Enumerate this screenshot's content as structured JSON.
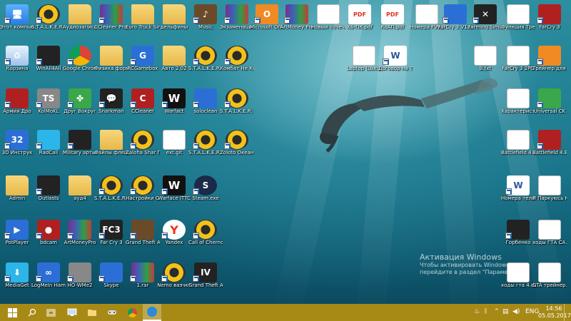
{
  "watermark": {
    "title": "Активация Windows",
    "subtitle": "Чтобы активировать Windows, перейдите в раздел \"Параметры\"."
  },
  "taskbar": {
    "language": "ENG",
    "time": "14:56",
    "date": "05.05.2017"
  },
  "icons": [
    {
      "label": "Этот компьютер",
      "kind": "pc",
      "glyph": "🖥"
    },
    {
      "label": "S.T.A.L.K.E.R. World Tour",
      "kind": "rad",
      "glyph": ""
    },
    {
      "label": "Аудиозаписи Владислав",
      "kind": "folder",
      "glyph": ""
    },
    {
      "label": "CCleaner Pro Коллекция",
      "kind": "rar",
      "glyph": ""
    },
    {
      "label": "Euro Truck Simulator 2",
      "kind": "folder",
      "glyph": ""
    },
    {
      "label": "дельфины",
      "kind": "folder",
      "glyph": ""
    },
    {
      "label": "Music",
      "kind": "brown",
      "glyph": "♪"
    },
    {
      "label": "Экзаменационные билеты ПДД",
      "kind": "rar",
      "glyph": ""
    },
    {
      "label": "Microsoft Office 2016",
      "kind": "orange",
      "glyph": "O"
    },
    {
      "label": "ArtMoney Pro",
      "kind": "rar",
      "glyph": ""
    },
    {
      "label": "Новый точечный рисунок",
      "kind": "doc",
      "glyph": ""
    },
    {
      "label": "ХБ-ПК.pdf",
      "kind": "pdf",
      "glyph": "PDF"
    },
    {
      "label": "КоАП.pdf",
      "kind": "pdf",
      "glyph": "PDF"
    },
    {
      "label": "Номера FVWD.txt",
      "kind": "doc",
      "glyph": ""
    },
    {
      "label": "FarCry 3 V1.05 DLC",
      "kind": "blue",
      "glyph": ""
    },
    {
      "label": "Farming Simulator 2017",
      "kind": "dark",
      "glyph": "✕"
    },
    {
      "label": "Функция Трейнер",
      "kind": "doc",
      "glyph": ""
    },
    {
      "label": "FarCry 3",
      "kind": "red",
      "glyph": ""
    },
    {
      "label": "Корзина",
      "kind": "bin",
      "glyph": "♻"
    },
    {
      "label": "WinAll4All",
      "kind": "dark",
      "glyph": ""
    },
    {
      "label": "Google Chrome",
      "kind": "chrome",
      "glyph": ""
    },
    {
      "label": "Физика формулы",
      "kind": "folder",
      "glyph": ""
    },
    {
      "label": "RCGamebox",
      "kind": "blue",
      "glyph": "G"
    },
    {
      "label": "Авто 2.02",
      "kind": "folder",
      "glyph": ""
    },
    {
      "label": "S.T.A.L.K.E.R. Call of Pripyat",
      "kind": "rad",
      "glyph": ""
    },
    {
      "label": "Комбат Не Колхоз",
      "kind": "rad",
      "glyph": ""
    },
    {
      "label": "Laptop (Luxury) Б",
      "kind": "doc",
      "glyph": ""
    },
    {
      "label": "Договор на Т СДЕ",
      "kind": "word",
      "glyph": "W"
    },
    {
      "label": "B.txt",
      "kind": "doc",
      "glyph": ""
    },
    {
      "label": "FarCry 3 2PG",
      "kind": "doc",
      "glyph": ""
    },
    {
      "label": "Трейнер для FC3 +10",
      "kind": "orange",
      "glyph": ""
    },
    {
      "label": "Армия Дро",
      "kind": "red",
      "glyph": ""
    },
    {
      "label": "KolMoKL",
      "kind": "gray",
      "glyph": "TS"
    },
    {
      "label": "Друг Вокруг",
      "kind": "green",
      "glyph": "✤"
    },
    {
      "label": "Snarkman",
      "kind": "dark",
      "glyph": "💬"
    },
    {
      "label": "CCleaner",
      "kind": "red",
      "glyph": "C"
    },
    {
      "label": "Warfact",
      "kind": "w",
      "glyph": "W"
    },
    {
      "label": "soloclean",
      "kind": "blue",
      "glyph": ""
    },
    {
      "label": "S.T.A.L.K.E.R. Время Альянса",
      "kind": "rad",
      "glyph": ""
    },
    {
      "label": "Характеристики оружий.txt",
      "kind": "doc",
      "glyph": ""
    },
    {
      "label": "Universal CK",
      "kind": "green",
      "glyph": ""
    },
    {
      "label": "3D Инструк",
      "kind": "blue",
      "glyph": "32"
    },
    {
      "label": "RadCall",
      "kind": "cyan",
      "glyph": ""
    },
    {
      "label": "Military артых",
      "kind": "dark",
      "glyph": ""
    },
    {
      "label": "Файлы флешки",
      "kind": "folder",
      "glyph": ""
    },
    {
      "label": "Zaloha Shar Переписка",
      "kind": "rad",
      "glyph": ""
    },
    {
      "label": "ext.git",
      "kind": "doc",
      "glyph": ""
    },
    {
      "label": "S.T.A.L.K.E.R. - Clear Sky",
      "kind": "rad",
      "glyph": ""
    },
    {
      "label": "Zoloto Океан 2",
      "kind": "rad",
      "glyph": ""
    },
    {
      "label": "Battlefield 4 Трейнер.txt",
      "kind": "doc",
      "glyph": ""
    },
    {
      "label": "Battlefield 4.EXE",
      "kind": "red",
      "glyph": ""
    },
    {
      "label": "Admin",
      "kind": "folder",
      "glyph": ""
    },
    {
      "label": "Outlasts",
      "kind": "dark",
      "glyph": ""
    },
    {
      "label": "ауд4",
      "kind": "folder",
      "glyph": ""
    },
    {
      "label": "S.T.A.L.K.E.R. - Shadow",
      "kind": "rad",
      "glyph": ""
    },
    {
      "label": "Настройки ОСБ Excel",
      "kind": "rad",
      "glyph": ""
    },
    {
      "label": "Warface ITTC",
      "kind": "w",
      "glyph": "W"
    },
    {
      "label": "Steam.exe",
      "kind": "steam",
      "glyph": "S"
    },
    {
      "label": "Номера телефонов",
      "kind": "word",
      "glyph": "W"
    },
    {
      "label": "Я Паркуюсь Как Мудак",
      "kind": "doc",
      "glyph": ""
    },
    {
      "label": "PotPlayer",
      "kind": "blue",
      "glyph": "▶"
    },
    {
      "label": "bdcam",
      "kind": "red",
      "glyph": "●"
    },
    {
      "label": "ArtMoneyPro",
      "kind": "rar",
      "glyph": ""
    },
    {
      "label": "Far Cry 3",
      "kind": "dark",
      "glyph": "FC3"
    },
    {
      "label": "Grand Theft Auto San",
      "kind": "brown",
      "glyph": ""
    },
    {
      "label": "Yandex",
      "kind": "yandex",
      "glyph": "Y"
    },
    {
      "label": "Call of Chernobyl",
      "kind": "rad",
      "glyph": ""
    },
    {
      "label": "Горбенко",
      "kind": "dark",
      "glyph": ""
    },
    {
      "label": "ходы ГТА СА.txt",
      "kind": "doc",
      "glyph": ""
    },
    {
      "label": "MediaGet",
      "kind": "cyan",
      "glyph": "⬇"
    },
    {
      "label": "LogMeIn Hamachi",
      "kind": "blue",
      "glyph": "∞"
    },
    {
      "label": "HO-WMe2",
      "kind": "gray",
      "glyph": ""
    },
    {
      "label": "Skype",
      "kind": "blue",
      "glyph": ""
    },
    {
      "label": "1.rar",
      "kind": "rar",
      "glyph": ""
    },
    {
      "label": "Nemo ваэчкт",
      "kind": "rad",
      "glyph": ""
    },
    {
      "label": "Grand Theft Auto IV",
      "kind": "dark",
      "glyph": "IV"
    },
    {
      "label": "ходы гта 4.docx",
      "kind": "doc",
      "glyph": ""
    },
    {
      "label": "GTA трейнер.txt",
      "kind": "doc",
      "glyph": ""
    }
  ]
}
